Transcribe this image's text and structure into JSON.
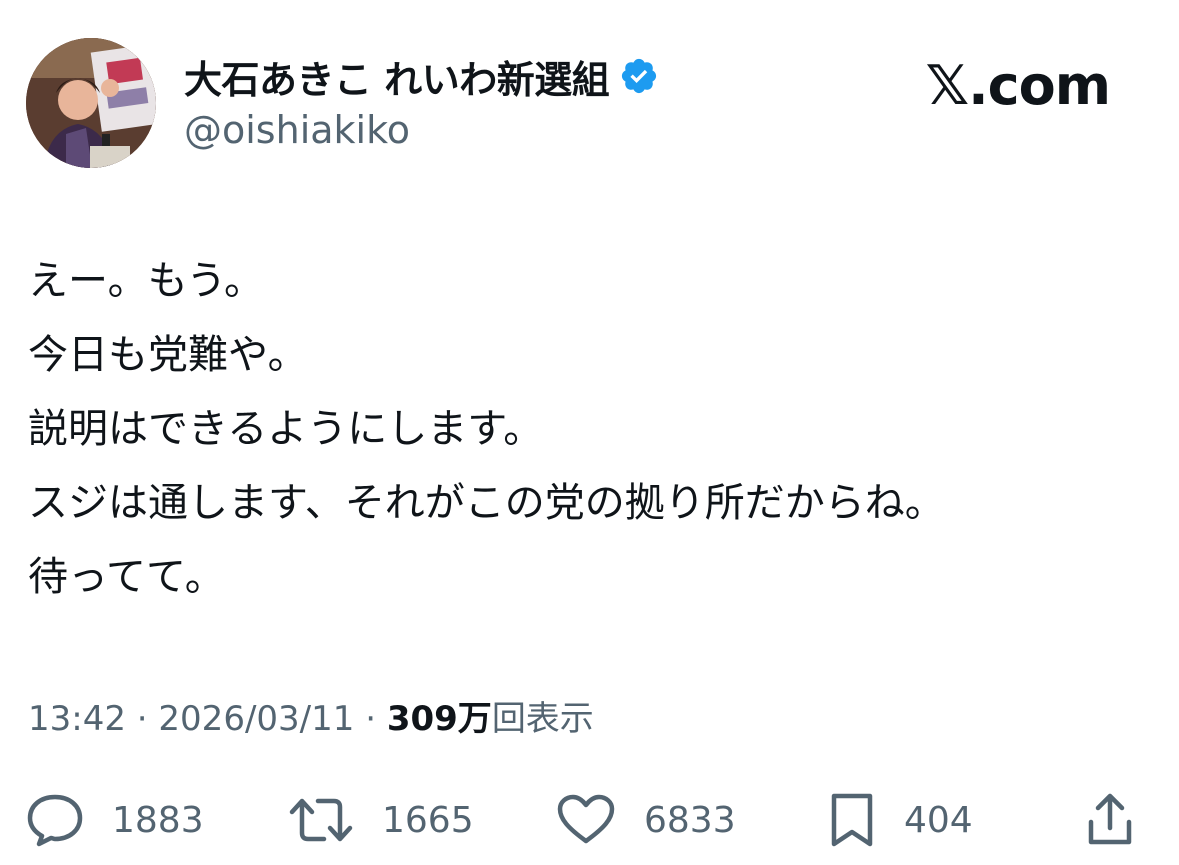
{
  "author": {
    "display_name": "大石あきこ れいわ新選組",
    "handle": "@oishiakiko",
    "verified_color": "#1d9bf0",
    "avatar_icon": "profile-photo"
  },
  "brand": {
    "label": "𝕏.com"
  },
  "tweet": {
    "lines": [
      "えー。もう。",
      "今日も党難や。",
      "説明はできるようにします。",
      "スジは通します、それがこの党の拠り所だからね。",
      "待ってて。"
    ]
  },
  "meta": {
    "time": "13:42",
    "separator": "·",
    "date": "2026/03/11",
    "views_count": "309万",
    "views_label": "回表示"
  },
  "actions": {
    "replies": {
      "icon": "reply-icon",
      "count": "1883"
    },
    "reposts": {
      "icon": "repost-icon",
      "count": "1665"
    },
    "likes": {
      "icon": "heart-icon",
      "count": "6833"
    },
    "bookmarks": {
      "icon": "bookmark-icon",
      "count": "404"
    },
    "share": {
      "icon": "share-icon"
    }
  },
  "colors": {
    "text_primary": "#0f1419",
    "text_secondary": "#536471",
    "accent": "#1d9bf0"
  }
}
